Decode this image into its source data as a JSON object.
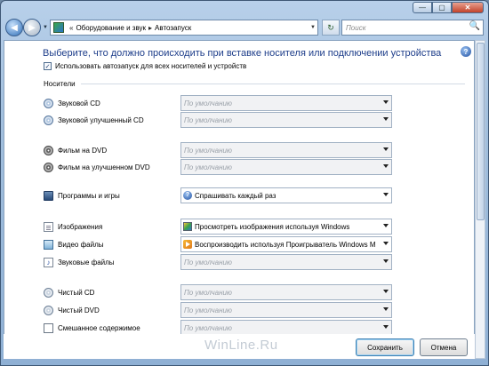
{
  "window": {
    "minimize_glyph": "—",
    "maximize_glyph": "▢",
    "close_glyph": "✕"
  },
  "navbar": {
    "back_glyph": "◀",
    "forward_glyph": "▶",
    "breadcrumb_prefix": "«",
    "breadcrumb": [
      "Оборудование и звук",
      "Автозапуск"
    ],
    "breadcrumb_separator": "▸",
    "refresh_glyph": "↻",
    "search_placeholder": "Поиск",
    "search_icon": "🔍"
  },
  "page": {
    "title": "Выберите, что должно происходить при вставке носителя или подключении устройства",
    "help_glyph": "?",
    "autoplay_checkbox": {
      "label": "Использовать автозапуск для всех носителей и устройств",
      "checked": true,
      "mark": "✓"
    },
    "section_label": "Носители"
  },
  "media": [
    {
      "icon": "audio-cd-icon",
      "label": "Звуковой CD",
      "value": "По умолчанию",
      "enabled": false
    },
    {
      "icon": "enhanced-audio-cd-icon",
      "label": "Звуковой улучшенный CD",
      "value": "По умолчанию",
      "enabled": false
    },
    {
      "icon": "dvd-movie-icon",
      "label": "Фильм на DVD",
      "value": "По умолчанию",
      "enabled": false
    },
    {
      "icon": "enhanced-dvd-movie-icon",
      "label": "Фильм на улучшенном DVD",
      "value": "По умолчанию",
      "enabled": false
    },
    {
      "icon": "programs-games-icon",
      "label": "Программы и игры",
      "value": "Спрашивать каждый раз",
      "enabled": true,
      "value_icon": "question-icon"
    },
    {
      "icon": "pictures-icon",
      "label": "Изображения",
      "value": "Просмотреть изображения используя Windows",
      "enabled": true,
      "value_icon": "image-viewer-icon"
    },
    {
      "icon": "video-files-icon",
      "label": "Видео файлы",
      "value": "Воспроизводить используя Проигрыватель Windows M",
      "enabled": true,
      "value_icon": "media-player-icon"
    },
    {
      "icon": "audio-files-icon",
      "label": "Звуковые файлы",
      "value": "По умолчанию",
      "enabled": false
    },
    {
      "icon": "blank-cd-icon",
      "label": "Чистый CD",
      "value": "По умолчанию",
      "enabled": false
    },
    {
      "icon": "blank-dvd-icon",
      "label": "Чистый DVD",
      "value": "По умолчанию",
      "enabled": false
    },
    {
      "icon": "mixed-content-icon",
      "label": "Смешанное содержимое",
      "value": "По умолчанию",
      "enabled": false
    }
  ],
  "footer": {
    "watermark": "WinLine.Ru",
    "save_label": "Сохранить",
    "cancel_label": "Отмена"
  }
}
